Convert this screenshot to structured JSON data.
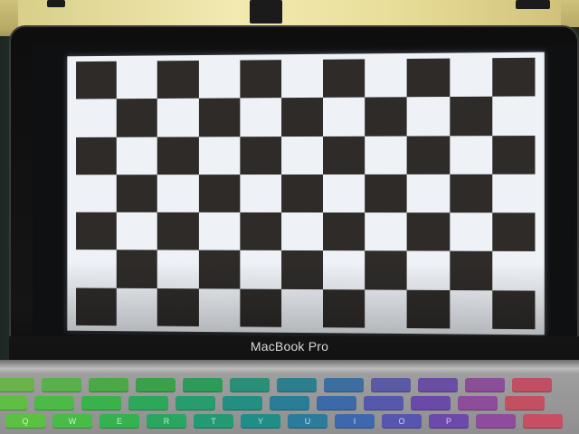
{
  "scene": {
    "laptop_brand_text": "MacBook Pro",
    "screen_content": "checkerboard",
    "checkerboard": {
      "columns": 11,
      "rows": 7
    }
  },
  "colors": {
    "checker_light": "#eef2f7",
    "checker_dark": "#2e2b29",
    "bezel": "#111111",
    "keyboard_base": "#9a9a9a"
  },
  "keyboard": {
    "row1": [
      {
        "label": "",
        "color": "#6ab34b"
      },
      {
        "label": "",
        "color": "#58b04a"
      },
      {
        "label": "",
        "color": "#4aa946"
      },
      {
        "label": "",
        "color": "#3aa14a"
      },
      {
        "label": "",
        "color": "#2d9a5a"
      },
      {
        "label": "",
        "color": "#2b8f77"
      },
      {
        "label": "",
        "color": "#2e7f8e"
      },
      {
        "label": "",
        "color": "#3d6ea0"
      },
      {
        "label": "",
        "color": "#5a5aa5"
      },
      {
        "label": "",
        "color": "#6a4ea3"
      },
      {
        "label": "",
        "color": "#8b4f98"
      },
      {
        "label": "",
        "color": "#c04f63"
      }
    ],
    "row2": [
      {
        "label": "",
        "color": "#5fbf42"
      },
      {
        "label": "",
        "color": "#4cbb45"
      },
      {
        "label": "",
        "color": "#3ab24b"
      },
      {
        "label": "",
        "color": "#2da85b"
      },
      {
        "label": "",
        "color": "#279c6d"
      },
      {
        "label": "",
        "color": "#228f82"
      },
      {
        "label": "",
        "color": "#2a7d96"
      },
      {
        "label": "",
        "color": "#3c6aa8"
      },
      {
        "label": "",
        "color": "#5658ad"
      },
      {
        "label": "",
        "color": "#6a4aa8"
      },
      {
        "label": "",
        "color": "#8d4d9a"
      },
      {
        "label": "",
        "color": "#c34f63"
      }
    ],
    "row3": [
      {
        "label": "Q",
        "color": "#5cc043"
      },
      {
        "label": "W",
        "color": "#48bc47"
      },
      {
        "label": "E",
        "color": "#33b24f"
      },
      {
        "label": "R",
        "color": "#29a660"
      },
      {
        "label": "T",
        "color": "#239a73"
      },
      {
        "label": "Y",
        "color": "#1f8d88"
      },
      {
        "label": "U",
        "color": "#2a7b9c"
      },
      {
        "label": "I",
        "color": "#3d68ad"
      },
      {
        "label": "O",
        "color": "#5655b0"
      },
      {
        "label": "P",
        "color": "#6d49ab"
      },
      {
        "label": "",
        "color": "#8f4b9c"
      },
      {
        "label": "",
        "color": "#c74f64"
      }
    ]
  }
}
